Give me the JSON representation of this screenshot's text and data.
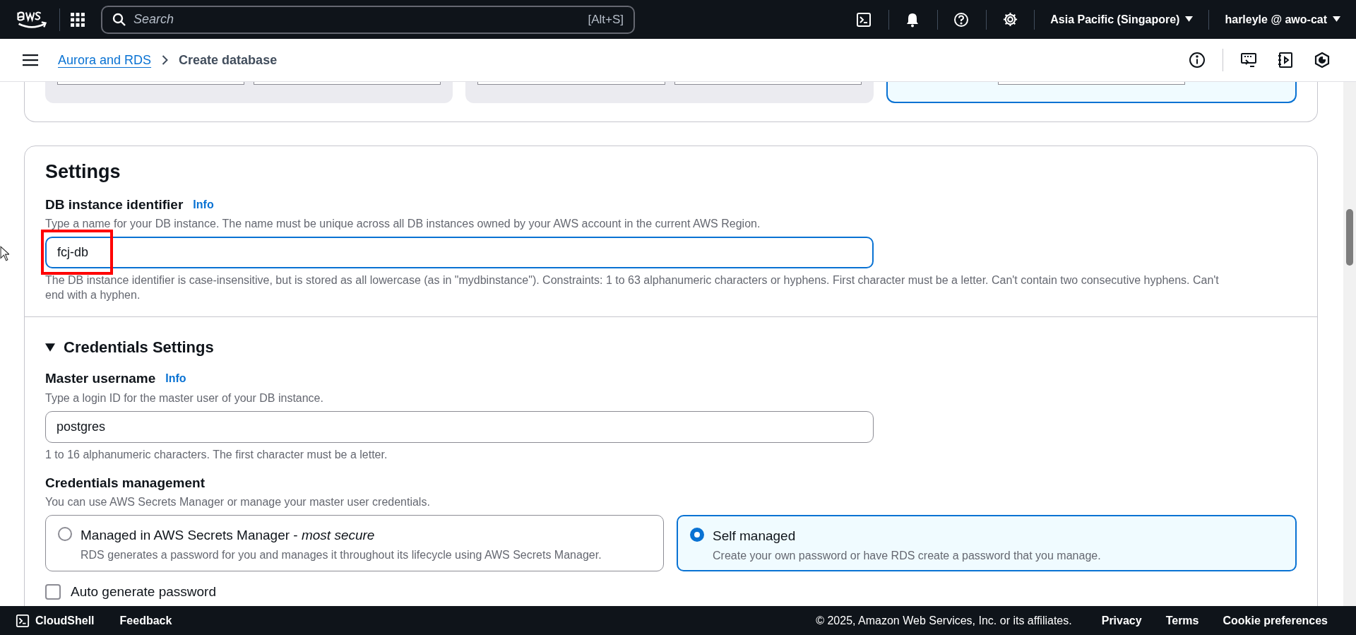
{
  "top_nav": {
    "search_placeholder": "Search",
    "search_shortcut": "[Alt+S]",
    "region": "Asia Pacific (Singapore)",
    "account": "harleyle @ awo-cat"
  },
  "breadcrumb": [
    {
      "label": "Aurora and RDS",
      "kind": "link"
    },
    {
      "label": "Create database",
      "kind": "current"
    }
  ],
  "previous_section": {
    "panels": [
      {
        "kind": "pair",
        "selected": false
      },
      {
        "kind": "pair",
        "selected": false
      },
      {
        "kind": "single",
        "selected": true
      }
    ]
  },
  "settings": {
    "title": "Settings",
    "identifier": {
      "label": "DB instance identifier",
      "info": "Info",
      "description": "Type a name for your DB instance. The name must be unique across all DB instances owned by your AWS account in the current AWS Region.",
      "value": "fcj-db",
      "focused": true,
      "highlighted": true,
      "constraint": "The DB instance identifier is case-insensitive, but is stored as all lowercase (as in \"mydbinstance\"). Constraints: 1 to 63 alphanumeric characters or hyphens. First character must be a letter. Can't contain two consecutive hyphens. Can't end with a hyphen."
    },
    "credentials": {
      "title": "Credentials Settings",
      "expanded": true,
      "username": {
        "label": "Master username",
        "info": "Info",
        "description": "Type a login ID for the master user of your DB instance.",
        "value": "postgres",
        "focused": false,
        "constraint": "1 to 16 alphanumeric characters. The first character must be a letter."
      },
      "management": {
        "label": "Credentials management",
        "description": "You can use AWS Secrets Manager or manage your master user credentials.",
        "options": [
          {
            "label": "Managed in AWS Secrets Manager - *most secure*",
            "description": "RDS generates a password for you and manages it throughout its lifecycle using AWS Secrets Manager.",
            "selected": false
          },
          {
            "label": "Self managed",
            "description": "Create your own password or have RDS create a password that you manage.",
            "selected": true
          }
        ]
      },
      "auto_password": {
        "label": "Auto generate password",
        "checked": false
      }
    }
  },
  "footer": {
    "cloudshell": "CloudShell",
    "feedback": "Feedback",
    "copyright": "© 2025, Amazon Web Services, Inc. or its affiliates.",
    "links": [
      "Privacy",
      "Terms",
      "Cookie preferences"
    ]
  }
}
